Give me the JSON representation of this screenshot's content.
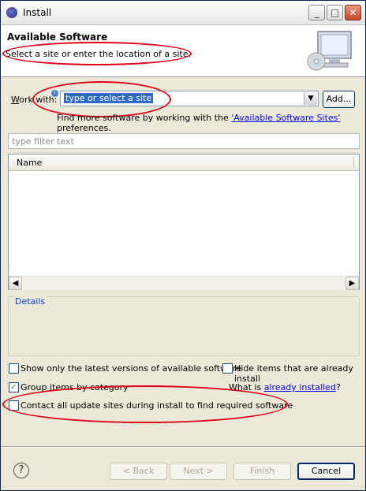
{
  "window": {
    "title": "Install",
    "icon": "eclipse-icon",
    "controls": {
      "minimize": "_",
      "maximize": "□",
      "close": "✕"
    }
  },
  "header": {
    "title": "Available Software",
    "subtitle": "Select a site or enter the location of a site.",
    "image": "monitor-cd-icon"
  },
  "work_with": {
    "label_prefix": "W",
    "label_rest": "ork with:",
    "value": "type or select a site",
    "add_button": "Add...",
    "find_more_prefix": "Find more software by working with the ",
    "find_more_link": "'Available Software Sites'",
    "find_more_suffix": " preferences."
  },
  "filter": {
    "placeholder": "type filter text"
  },
  "table": {
    "columns": [
      "Name"
    ],
    "rows": []
  },
  "details": {
    "label": "Details"
  },
  "options": {
    "show_latest": {
      "label": "Show only the latest versions of available software",
      "checked": false
    },
    "hide_installed": {
      "label": "Hide items that are already install",
      "checked": false
    },
    "group_by_category": {
      "label": "Group items by category",
      "checked": true
    },
    "what_is_prefix": "What is ",
    "what_is_link": "already installed",
    "what_is_suffix": "?",
    "contact_sites": {
      "label": "Contact all update sites during install to find required software",
      "checked": false
    }
  },
  "buttons": {
    "back": "< Back",
    "next": "Next >",
    "finish": "Finish",
    "cancel": "Cancel"
  },
  "colors": {
    "annotation_oval": "#e0001a",
    "link": "#0000ff"
  }
}
